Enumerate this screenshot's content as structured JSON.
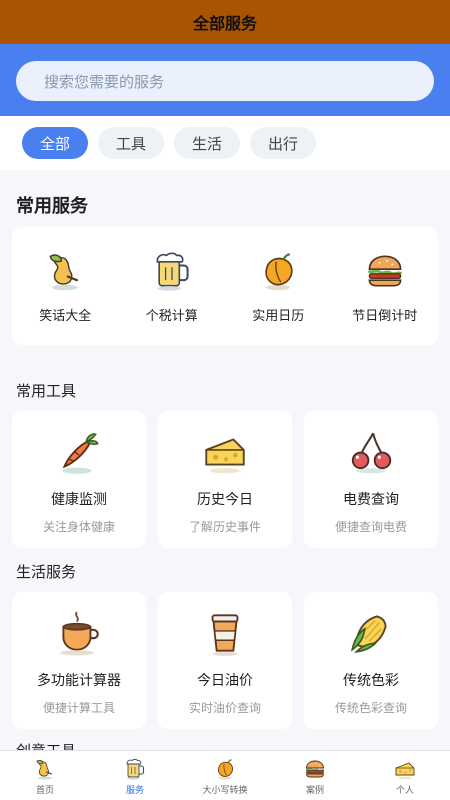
{
  "header": {
    "title": "全部服务"
  },
  "search": {
    "placeholder": "搜索您需要的服务"
  },
  "tabs": [
    {
      "label": "全部",
      "active": true
    },
    {
      "label": "工具",
      "active": false
    },
    {
      "label": "生活",
      "active": false
    },
    {
      "label": "出行",
      "active": false
    }
  ],
  "common_services": {
    "title": "常用服务",
    "items": [
      {
        "label": "笑话大全",
        "icon": "pear-icon"
      },
      {
        "label": "个税计算",
        "icon": "beer-mug-icon"
      },
      {
        "label": "实用日历",
        "icon": "bell-pepper-icon"
      },
      {
        "label": "节日倒计时",
        "icon": "burger-icon"
      }
    ]
  },
  "common_tools": {
    "title": "常用工具",
    "items": [
      {
        "name": "健康监测",
        "desc": "关注身体健康",
        "icon": "carrot-icon"
      },
      {
        "name": "历史今日",
        "desc": "了解历史事件",
        "icon": "cheese-icon"
      },
      {
        "name": "电费查询",
        "desc": "便捷查询电费",
        "icon": "cherry-icon"
      }
    ]
  },
  "life_services": {
    "title": "生活服务",
    "items": [
      {
        "name": "多功能计算器",
        "desc": "便捷计算工具",
        "icon": "coffee-cup-icon"
      },
      {
        "name": "今日油价",
        "desc": "实时油价查询",
        "icon": "takeaway-coffee-icon"
      },
      {
        "name": "传统色彩",
        "desc": "传统色彩查询",
        "icon": "corn-icon"
      }
    ]
  },
  "creative_tools": {
    "title": "创意工具"
  },
  "bottom_nav": [
    {
      "label": "首页",
      "icon": "pear-icon",
      "active": false
    },
    {
      "label": "服务",
      "icon": "beer-mug-icon",
      "active": true
    },
    {
      "label": "大小写转换",
      "icon": "bell-pepper-icon",
      "active": false
    },
    {
      "label": "案例",
      "icon": "burger-icon",
      "active": false
    },
    {
      "label": "个人",
      "icon": "cheese-icon",
      "active": false
    }
  ],
  "colors": {
    "header_bg": "#a85400",
    "accent_blue": "#4a7ff0",
    "page_bg": "#f5f7fa"
  }
}
